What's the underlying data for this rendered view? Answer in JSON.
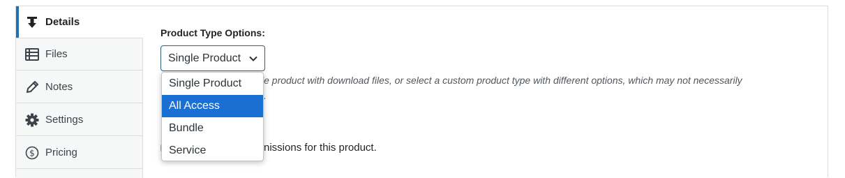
{
  "sidebar": {
    "items": [
      {
        "label": "Details",
        "icon": "download-arrow-icon",
        "active": true
      },
      {
        "label": "Files",
        "icon": "list-icon",
        "active": false
      },
      {
        "label": "Notes",
        "icon": "pencil-icon",
        "active": false
      },
      {
        "label": "Settings",
        "icon": "gear-icon",
        "active": false
      },
      {
        "label": "Pricing",
        "icon": "dollar-circle-icon",
        "active": false
      }
    ]
  },
  "main": {
    "product_type_label": "Product Type Options:",
    "select_value": "Single Product",
    "description_text": "le product with download files, or select a custom product type with different options, which may not necessarily",
    "description_link": ".",
    "permissions_text": "nissions for this product."
  },
  "dropdown": {
    "options": [
      "Single Product",
      "All Access",
      "Bundle",
      "Service"
    ],
    "highlighted": "All Access"
  },
  "colors": {
    "accent": "#2271b1",
    "highlight": "#1a6fd2",
    "sidebar_bg": "#f6f7f7",
    "border": "#dcdcde"
  }
}
